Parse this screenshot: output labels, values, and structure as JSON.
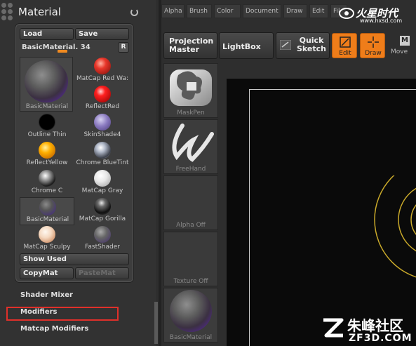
{
  "tray": {
    "title": "Material"
  },
  "panel": {
    "load": "Load",
    "save": "Save",
    "slider_label": "BasicMaterial.",
    "slider_value": "34",
    "r_button": "R",
    "show_used": "Show Used",
    "copy_mat": "CopyMat",
    "paste_mat": "PasteMat",
    "materials": [
      {
        "label": "BasicMaterial"
      },
      {
        "label": "MatCap Red Wa:"
      },
      {
        "label": "ReflectRed"
      },
      {
        "label": "Outline Thin"
      },
      {
        "label": "SkinShade4"
      },
      {
        "label": "ReflectYellow"
      },
      {
        "label": "Chrome BlueTint"
      },
      {
        "label": "Chrome C"
      },
      {
        "label": "MatCap Gray"
      },
      {
        "label": "BasicMaterial"
      },
      {
        "label": "MatCap Gorilla"
      },
      {
        "label": "MatCap Sculpy"
      },
      {
        "label": "FastShader"
      }
    ]
  },
  "submenus": {
    "shader_mixer": "Shader Mixer",
    "modifiers": "Modifiers",
    "matcap_modifiers": "Matcap Modifiers"
  },
  "menus": [
    "Alpha",
    "Brush",
    "Color",
    "Document",
    "Draw",
    "Edit",
    "Fil"
  ],
  "toolbar": {
    "projection_master": "Projection Master",
    "lightbox": "LightBox",
    "quick_sketch": "Quick Sketch",
    "edit": "Edit",
    "draw": "Draw",
    "move": "Move",
    "move_key": "M"
  },
  "slots": {
    "brush": "MaskPen",
    "stroke": "FreeHand",
    "alpha": "Alpha Off",
    "texture": "Texture Off",
    "material": "BasicMaterial"
  },
  "watermarks": {
    "top_text": "火星时代",
    "top_url": "www.hxsd.com",
    "bottom_cn": "朱峰社区",
    "bottom_en": "ZF3D.COM"
  },
  "colors": {
    "accent": "#ef7d1a",
    "highlight_box": "#e0302a",
    "ring": "#c9a92a"
  }
}
